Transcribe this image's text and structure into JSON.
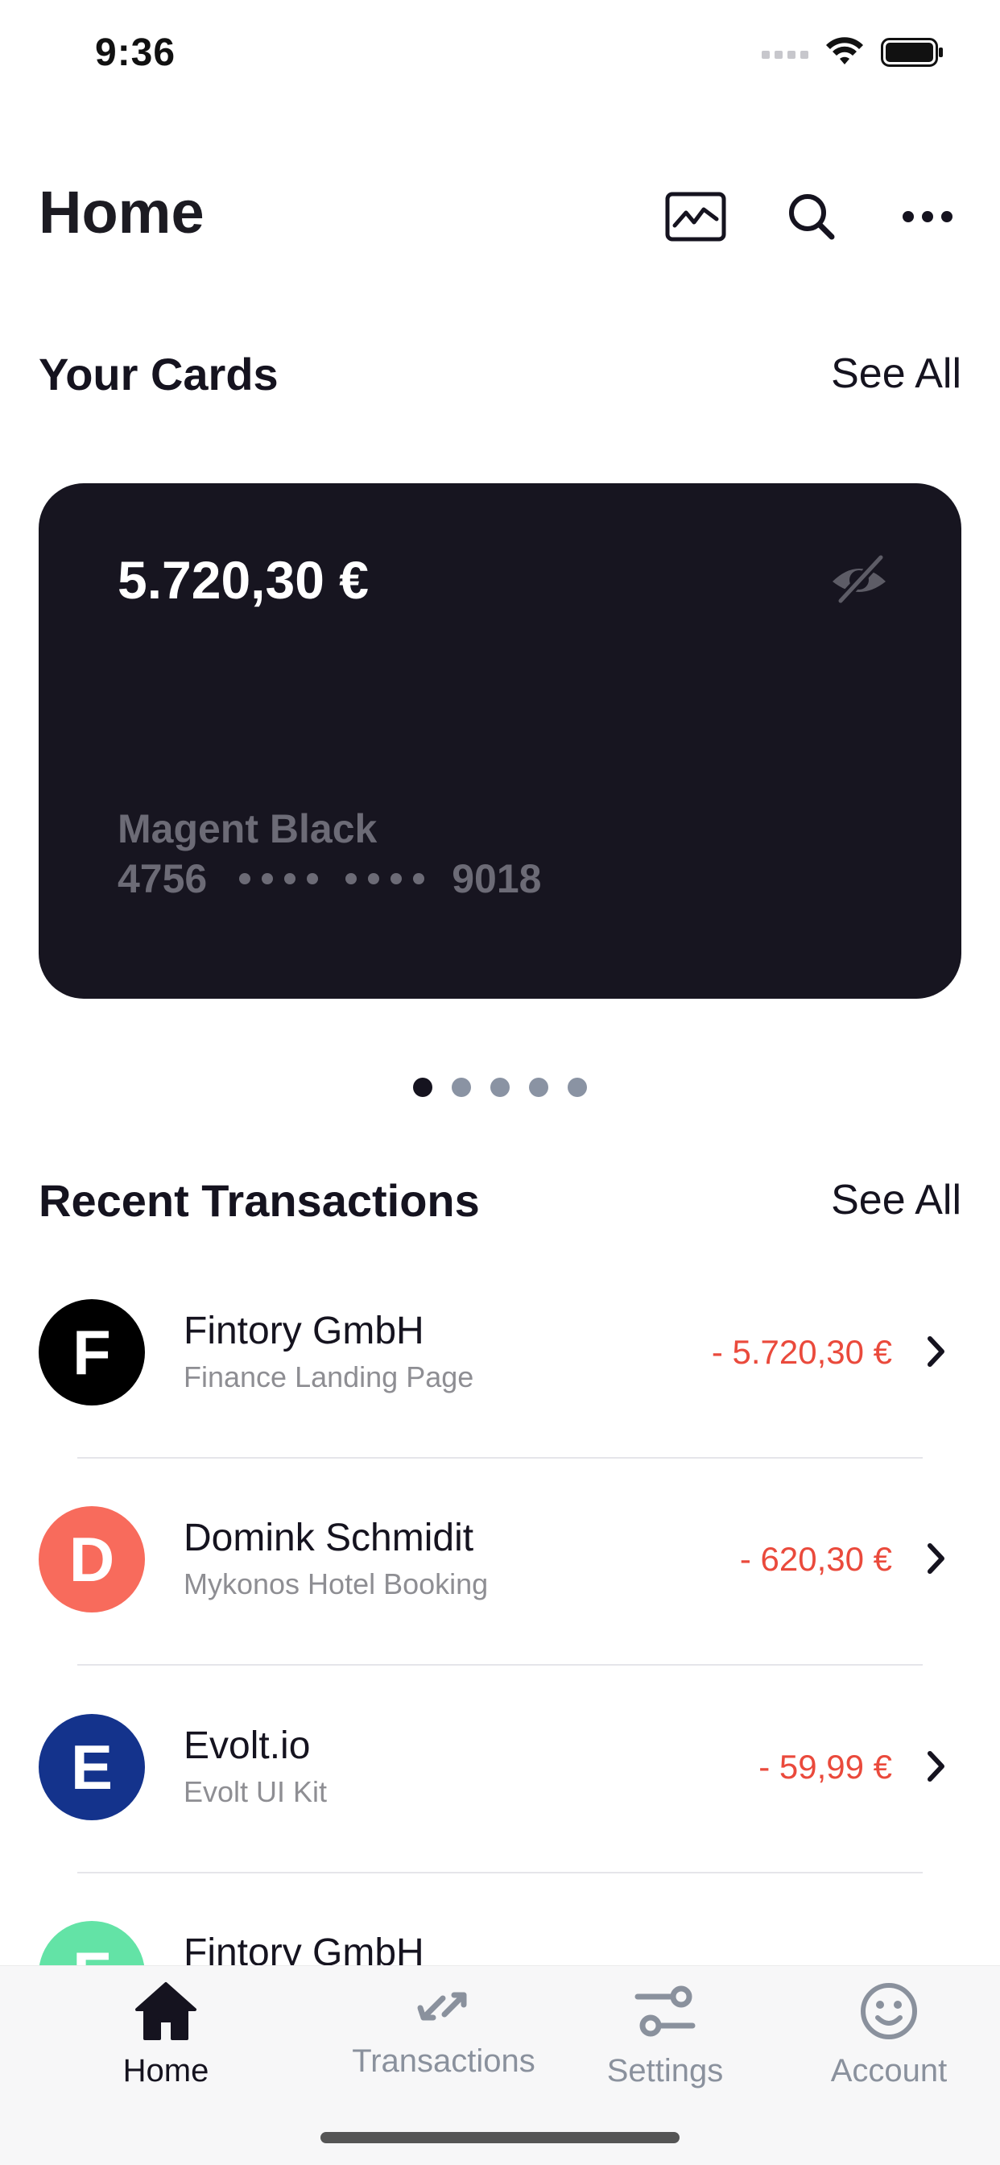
{
  "status_bar": {
    "time": "9:36"
  },
  "header": {
    "title": "Home",
    "actions": [
      "chart-icon",
      "search-icon",
      "more-icon"
    ]
  },
  "cards_section": {
    "title": "Your Cards",
    "see_all": "See All"
  },
  "card": {
    "balance": "5.720,30 €",
    "name": "Magent Black",
    "number_start": "4756",
    "number_end": "9018",
    "background": "#171520"
  },
  "pager": {
    "count": 5,
    "active_index": 0
  },
  "transactions_section": {
    "title": "Recent Transactions",
    "see_all": "See All"
  },
  "transactions": [
    {
      "initial": "F",
      "title": "Fintory GmbH",
      "subtitle": "Finance Landing Page",
      "amount": "- 5.720,30 €",
      "color": "#000000"
    },
    {
      "initial": "D",
      "title": "Domink Schmidit",
      "subtitle": "Mykonos Hotel Booking",
      "amount": "- 620,30 €",
      "color": "#f86b5c"
    },
    {
      "initial": "E",
      "title": "Evolt.io",
      "subtitle": "Evolt UI Kit",
      "amount": "- 59,99 €",
      "color": "#14338c"
    },
    {
      "initial": "F",
      "title": "Fintory GmbH",
      "subtitle": "",
      "amount": "",
      "color": "#63e3a6"
    }
  ],
  "tab_bar": {
    "tabs": [
      {
        "label": "Home",
        "icon": "home-icon",
        "active": true
      },
      {
        "label": "Transactions",
        "icon": "transfer-arrows-icon",
        "active": false
      },
      {
        "label": "Settings",
        "icon": "sliders-icon",
        "active": false
      },
      {
        "label": "Account",
        "icon": "smiley-icon",
        "active": false
      }
    ]
  },
  "colors": {
    "accent_negative": "#ea4a3c",
    "text_primary": "#15131f",
    "text_secondary": "#8e8e93"
  }
}
